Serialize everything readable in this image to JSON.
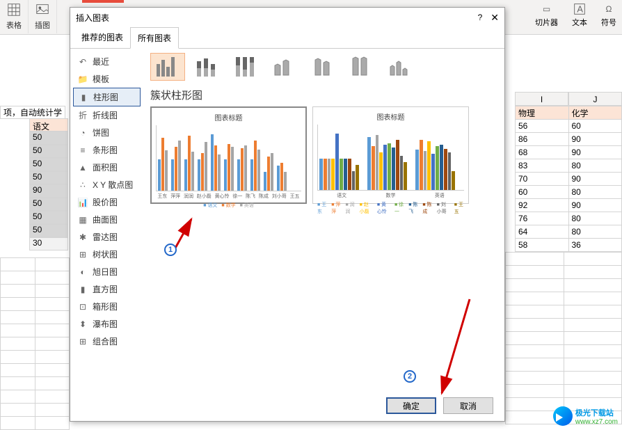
{
  "ribbon": {
    "groups": [
      {
        "label": "表格"
      },
      {
        "label": "插图"
      }
    ],
    "far": [
      {
        "label": "切片器"
      },
      {
        "label": "文本"
      },
      {
        "label": "符号"
      }
    ]
  },
  "sheet": {
    "row_desc": "项，自动统计学",
    "left_header": "语文",
    "left_values": [
      "50",
      "50",
      "50",
      "50",
      "90",
      "50",
      "50",
      "50",
      "30"
    ],
    "col_headers": [
      "I",
      "J"
    ],
    "right_headers": [
      "物理",
      "化学"
    ],
    "right_rows": [
      [
        "56",
        "60"
      ],
      [
        "86",
        "90"
      ],
      [
        "68",
        "90"
      ],
      [
        "83",
        "80"
      ],
      [
        "70",
        "90"
      ],
      [
        "60",
        "80"
      ],
      [
        "92",
        "90"
      ],
      [
        "76",
        "80"
      ],
      [
        "64",
        "80"
      ],
      [
        "58",
        "36"
      ]
    ]
  },
  "dialog": {
    "title": "插入图表",
    "tabs": {
      "recommended": "推荐的图表",
      "all": "所有图表"
    },
    "sidebar": [
      {
        "label": "最近"
      },
      {
        "label": "模板"
      },
      {
        "label": "柱形图"
      },
      {
        "label": "折线图"
      },
      {
        "label": "饼图"
      },
      {
        "label": "条形图"
      },
      {
        "label": "面积图"
      },
      {
        "label": "X Y 散点图"
      },
      {
        "label": "股价图"
      },
      {
        "label": "曲面图"
      },
      {
        "label": "雷达图"
      },
      {
        "label": "树状图"
      },
      {
        "label": "旭日图"
      },
      {
        "label": "直方图"
      },
      {
        "label": "箱形图"
      },
      {
        "label": "瀑布图"
      },
      {
        "label": "组合图"
      }
    ],
    "subtitle": "簇状柱形图",
    "preview_title": "图表标题",
    "preview1_xlabels": [
      "王东",
      "萍萍",
      "润润",
      "赵小磊",
      "黄心怜",
      "徐一",
      "陈飞",
      "陈成",
      "刘小哥",
      "王五"
    ],
    "preview1_legend": [
      "语文",
      "数学",
      "英语"
    ],
    "preview2_groups": [
      "语文",
      "数学",
      "英语"
    ],
    "preview2_legend": [
      "王东",
      "萍萍",
      "润润",
      "赵小磊",
      "黄心怜",
      "徐一",
      "陈飞",
      "陈成",
      "刘小哥",
      "王五"
    ],
    "ok": "确定",
    "cancel": "取消"
  },
  "callouts": {
    "one": "1",
    "two": "2"
  },
  "watermark": {
    "cn": "极光下载站",
    "en": "www.xz7.com"
  },
  "chart_data": {
    "type": "bar",
    "title": "图表标题",
    "categories": [
      "王东",
      "萍萍",
      "润润",
      "赵小磊",
      "黄心怜",
      "徐一",
      "陈飞",
      "陈成",
      "刘小哥",
      "王五"
    ],
    "series": [
      {
        "name": "语文",
        "values": [
          50,
          50,
          50,
          50,
          90,
          50,
          50,
          50,
          30,
          40
        ]
      },
      {
        "name": "数学",
        "values": [
          85,
          70,
          88,
          60,
          72,
          75,
          68,
          80,
          55,
          45
        ]
      },
      {
        "name": "英语",
        "values": [
          65,
          80,
          62,
          78,
          58,
          70,
          72,
          66,
          60,
          30
        ]
      }
    ],
    "ylim": [
      0,
      100
    ]
  }
}
